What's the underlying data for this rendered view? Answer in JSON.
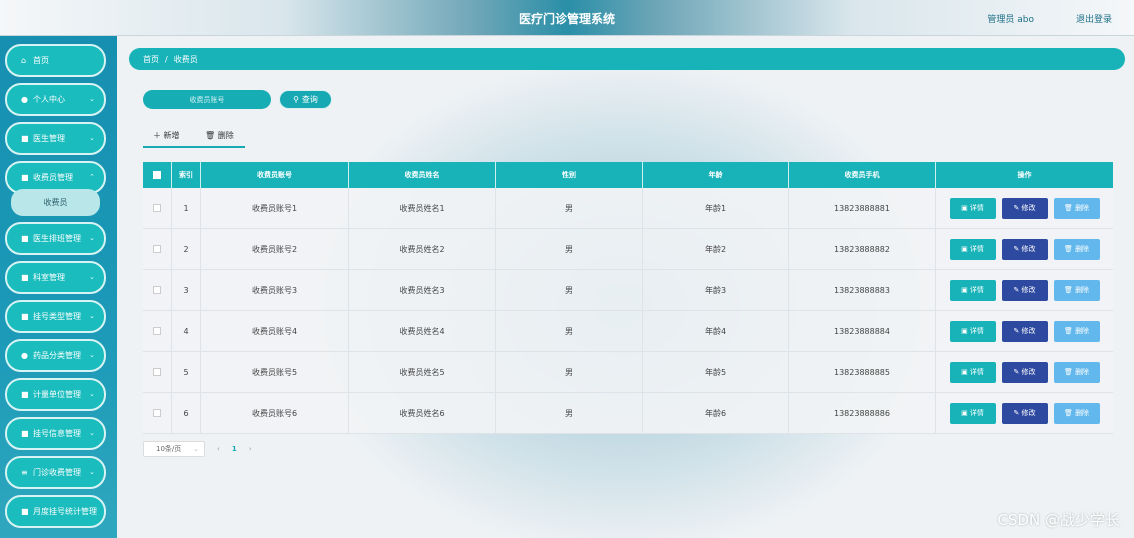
{
  "header": {
    "title": "医疗门诊管理系统",
    "user": "管理员 abo",
    "logout": "退出登录"
  },
  "sidebar": {
    "items": [
      {
        "label": "首页",
        "icon": "⌂"
      },
      {
        "label": "个人中心",
        "icon": "●"
      },
      {
        "label": "医生管理",
        "icon": "■"
      },
      {
        "label": "收费员管理",
        "icon": "■"
      },
      {
        "label": "医生排班管理",
        "icon": "■"
      },
      {
        "label": "科室管理",
        "icon": "■"
      },
      {
        "label": "挂号类型管理",
        "icon": "■"
      },
      {
        "label": "药品分类管理",
        "icon": "●"
      },
      {
        "label": "计量单位管理",
        "icon": "■"
      },
      {
        "label": "挂号信息管理",
        "icon": "■"
      },
      {
        "label": "门诊收费管理",
        "icon": "≡"
      },
      {
        "label": "月度挂号统计管理",
        "icon": "■"
      }
    ],
    "sub_item": "收费员"
  },
  "breadcrumb": {
    "home": "首页",
    "sep": "/",
    "current": "收费员"
  },
  "search": {
    "placeholder": "收费员账号",
    "button": "查询"
  },
  "actions": {
    "add": "新增",
    "delete": "删除"
  },
  "table": {
    "headers": [
      "",
      "索引",
      "收费员账号",
      "收费员姓名",
      "性别",
      "年龄",
      "收费员手机",
      "操作"
    ],
    "rows": [
      {
        "index": "1",
        "account": "收费员账号1",
        "name": "收费员姓名1",
        "gender": "男",
        "age": "年龄1",
        "phone": "13823888881"
      },
      {
        "index": "2",
        "account": "收费员账号2",
        "name": "收费员姓名2",
        "gender": "男",
        "age": "年龄2",
        "phone": "13823888882"
      },
      {
        "index": "3",
        "account": "收费员账号3",
        "name": "收费员姓名3",
        "gender": "男",
        "age": "年龄3",
        "phone": "13823888883"
      },
      {
        "index": "4",
        "account": "收费员账号4",
        "name": "收费员姓名4",
        "gender": "男",
        "age": "年龄4",
        "phone": "13823888884"
      },
      {
        "index": "5",
        "account": "收费员账号5",
        "name": "收费员姓名5",
        "gender": "男",
        "age": "年龄5",
        "phone": "13823888885"
      },
      {
        "index": "6",
        "account": "收费员账号6",
        "name": "收费员姓名6",
        "gender": "男",
        "age": "年龄6",
        "phone": "13823888886"
      }
    ],
    "row_buttons": {
      "detail": "详情",
      "edit": "修改",
      "delete": "删除"
    }
  },
  "pager": {
    "page_size": "10条/页",
    "current_page": "1"
  },
  "watermark": "CSDN @战少学长",
  "colors": {
    "teal": "#17b3b8",
    "edit": "#2e4aa0",
    "delete": "#62b8ec"
  }
}
